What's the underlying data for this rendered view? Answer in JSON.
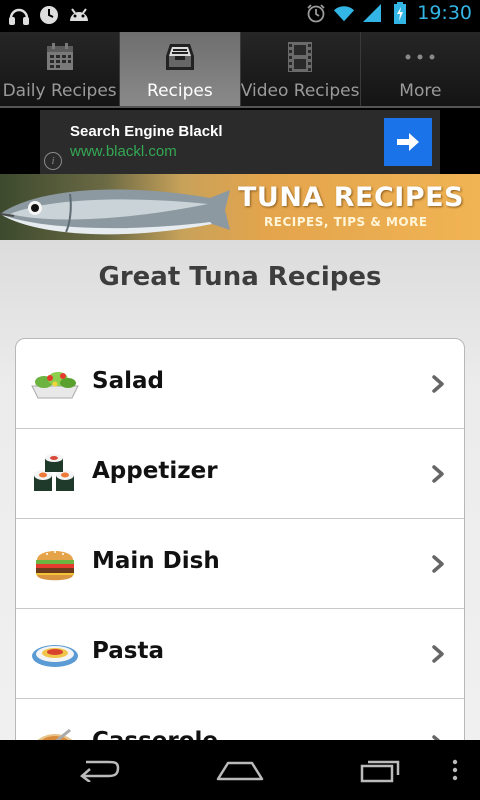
{
  "status_bar": {
    "time": "19:30",
    "icons": [
      "headphones-icon",
      "clock-icon",
      "android-icon",
      "alarm-icon",
      "wifi-icon",
      "signal-icon",
      "battery-charging-icon"
    ],
    "time_color": "#33b5e5"
  },
  "tabs": [
    {
      "label": "Daily Recipes",
      "icon": "calendar-icon",
      "active": false
    },
    {
      "label": "Recipes",
      "icon": "inbox-icon",
      "active": true
    },
    {
      "label": "Video Recipes",
      "icon": "film-icon",
      "active": false
    },
    {
      "label": "More",
      "icon": "more-dots-icon",
      "active": false
    }
  ],
  "ad": {
    "title": "Search Engine Blackl",
    "url": "www.blackl.com",
    "info": "i",
    "url_color": "#34a853",
    "button_color": "#1a73e8"
  },
  "banner": {
    "title": "TUNA RECIPES",
    "subtitle": "RECIPES, TIPS & MORE"
  },
  "main": {
    "title": "Great Tuna Recipes",
    "categories": [
      {
        "label": "Salad",
        "icon": "salad-icon"
      },
      {
        "label": "Appetizer",
        "icon": "sushi-icon"
      },
      {
        "label": "Main Dish",
        "icon": "burger-icon"
      },
      {
        "label": "Pasta",
        "icon": "pasta-icon"
      },
      {
        "label": "Casserole",
        "icon": "casserole-icon"
      }
    ]
  },
  "nav_bar": {
    "buttons": [
      "back-icon",
      "home-icon",
      "recent-apps-icon",
      "menu-icon"
    ]
  }
}
